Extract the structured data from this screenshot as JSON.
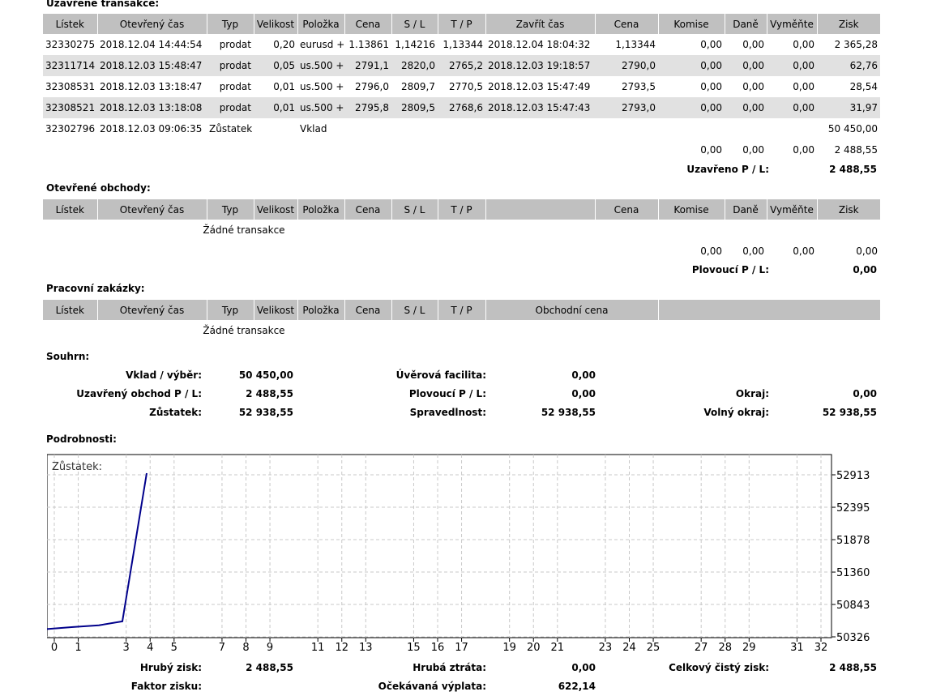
{
  "closed": {
    "title": "Uzavřené transakce:",
    "headers": [
      "Lístek",
      "Otevřený čas",
      "Typ",
      "Velikost",
      "Položka",
      "Cena",
      "S / L",
      "T / P",
      "Zavřít čas",
      "Cena",
      "Komise",
      "Daně",
      "Vyměňte",
      "Zisk"
    ],
    "rows": [
      [
        "32330275",
        "2018.12.04 14:44:54",
        "prodat",
        "0,20",
        "eurusd +",
        "1.13861",
        "1,14216",
        "1,13344",
        "2018.12.04 18:04:32",
        "1,13344",
        "0,00",
        "0,00",
        "0,00",
        "2 365,28"
      ],
      [
        "32311714",
        "2018.12.03 15:48:47",
        "prodat",
        "0,05",
        "us.500 +",
        "2791,1",
        "2820,0",
        "2765,2",
        "2018.12.03 19:18:57",
        "2790,0",
        "0,00",
        "0,00",
        "0,00",
        "62,76"
      ],
      [
        "32308531",
        "2018.12.03 13:18:47",
        "prodat",
        "0,01",
        "us.500 +",
        "2796,0",
        "2809,7",
        "2770,5",
        "2018.12.03 15:47:49",
        "2793,5",
        "0,00",
        "0,00",
        "0,00",
        "28,54"
      ],
      [
        "32308521",
        "2018.12.03 13:18:08",
        "prodat",
        "0,01",
        "us.500 +",
        "2795,8",
        "2809,5",
        "2768,6",
        "2018.12.03 15:47:43",
        "2793,0",
        "0,00",
        "0,00",
        "0,00",
        "31,97"
      ]
    ],
    "balance_row": {
      "ticket": "32302796",
      "time": "2018.12.03 09:06:35",
      "type": "Zůstatek",
      "item": "Vklad",
      "profit": "50 450,00"
    },
    "totals": {
      "komise": "0,00",
      "dane": "0,00",
      "vymente": "0,00",
      "zisk": "2 488,55"
    },
    "pl_label": "Uzavřeno P / L:",
    "pl_value": "2 488,55"
  },
  "open": {
    "title": "Otevřené obchody:",
    "headers": [
      "Lístek",
      "Otevřený čas",
      "Typ",
      "Velikost",
      "Položka",
      "Cena",
      "S / L",
      "T / P",
      "",
      "Cena",
      "Komise",
      "Daně",
      "Vyměňte",
      "Zisk"
    ],
    "empty": "Žádné transakce",
    "totals": {
      "komise": "0,00",
      "dane": "0,00",
      "vymente": "0,00",
      "zisk": "0,00"
    },
    "pl_label": "Plovoucí P / L:",
    "pl_value": "0,00"
  },
  "working": {
    "title": "Pracovní zakázky:",
    "headers": [
      "Lístek",
      "Otevřený čas",
      "Typ",
      "Velikost",
      "Položka",
      "Cena",
      "S / L",
      "T / P",
      "Obchodní cena",
      ""
    ],
    "empty": "Žádné transakce"
  },
  "summary": {
    "title": "Souhrn:",
    "deposit_label": "Vklad / výběr:",
    "deposit_value": "50 450,00",
    "closed_pl_label": "Uzavřený obchod P / L:",
    "closed_pl_value": "2 488,55",
    "balance_label": "Zůstatek:",
    "balance_value": "52 938,55",
    "credit_label": "Úvěrová facilita:",
    "credit_value": "0,00",
    "floating_label": "Plovoucí P / L:",
    "floating_value": "0,00",
    "equity_label": "Spravedlnost:",
    "equity_value": "52 938,55",
    "margin_label": "Okraj:",
    "margin_value": "0,00",
    "free_margin_label": "Volný okraj:",
    "free_margin_value": "52 938,55"
  },
  "details": {
    "title": "Podrobnosti:",
    "gross_profit_label": "Hrubý zisk:",
    "gross_profit_value": "2 488,55",
    "gross_loss_label": "Hrubá ztráta:",
    "gross_loss_value": "0,00",
    "net_profit_label": "Celkový čistý zisk:",
    "net_profit_value": "2 488,55",
    "profit_factor_label": "Faktor zisku:",
    "expected_payoff_label": "Očekávaná výplata:",
    "expected_payoff_value": "622,14"
  },
  "chart_data": {
    "type": "line",
    "title": "Zůstatek:",
    "x": [
      0,
      1,
      2,
      3,
      4
    ],
    "values": [
      50450.0,
      50481.97,
      50510.51,
      50573.27,
      52938.55
    ],
    "x_ticks": [
      0,
      1,
      3,
      4,
      5,
      7,
      8,
      9,
      11,
      12,
      13,
      15,
      16,
      17,
      19,
      20,
      21,
      23,
      24,
      25,
      27,
      28,
      29,
      31,
      32
    ],
    "y_ticks": [
      52913,
      52395,
      51878,
      51360,
      50843,
      50326
    ],
    "xlim": [
      0,
      32
    ],
    "ylim": [
      50326,
      52913
    ],
    "grid": true,
    "line_color": "#00008b"
  }
}
